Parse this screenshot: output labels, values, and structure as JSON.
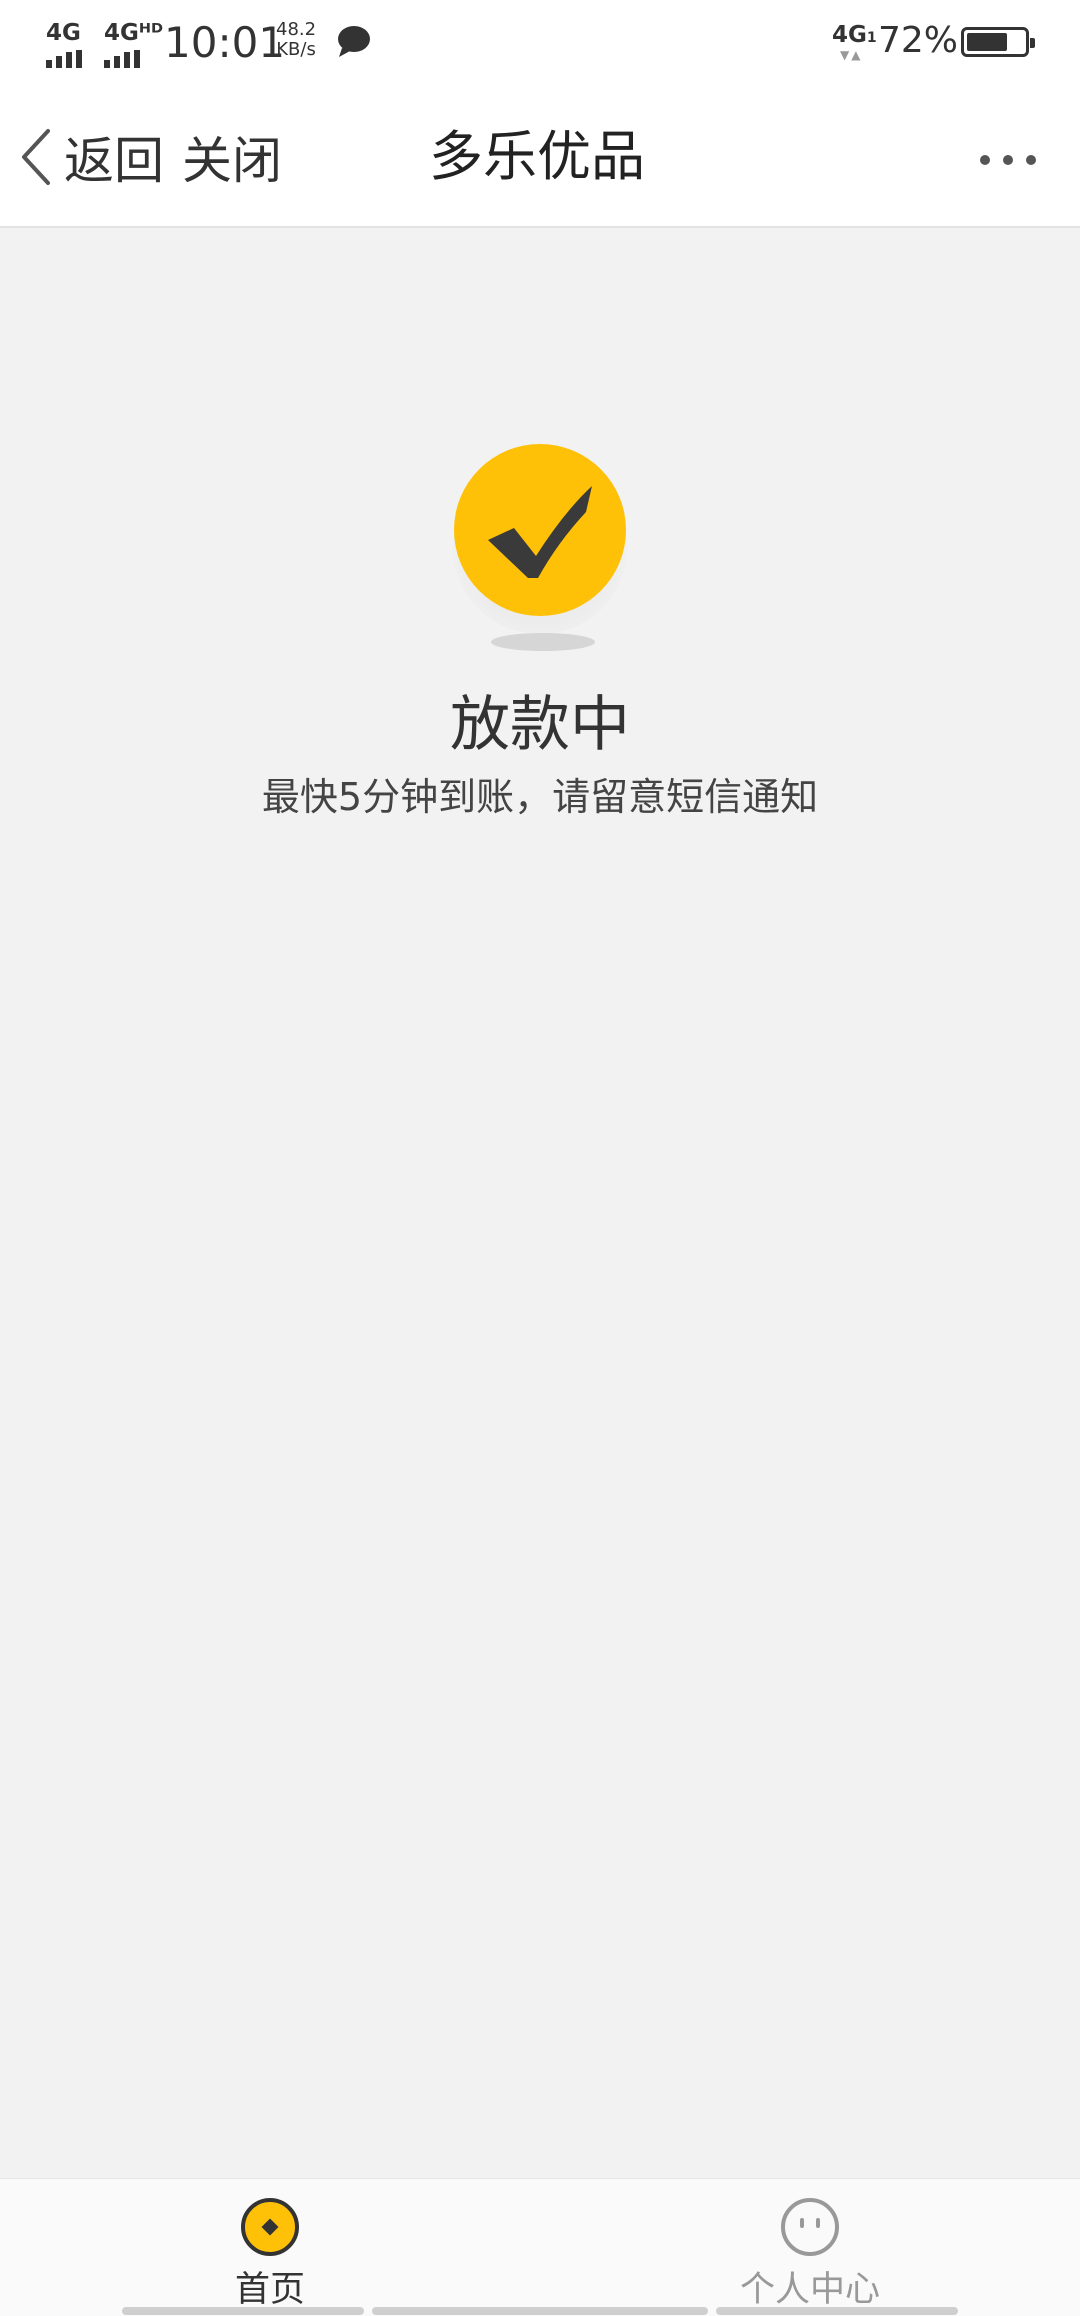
{
  "status_bar": {
    "sim1_label": "4G",
    "sim2_label": "4Gᴴᴰ",
    "time": "10:01",
    "net_speed_value": "48.2",
    "net_speed_unit": "KB/s",
    "right_network": "4G",
    "right_network_sub": "1",
    "battery_percent": "72%",
    "battery_level": 0.72
  },
  "nav": {
    "back_label": "返回",
    "close_label": "关闭",
    "title": "多乐优品"
  },
  "content": {
    "status_title": "放款中",
    "status_desc": "最快5分钟到账，请留意短信通知"
  },
  "tabs": [
    {
      "label": "首页",
      "active": true
    },
    {
      "label": "个人中心",
      "active": false
    }
  ],
  "colors": {
    "accent": "#FFC107",
    "check": "#3a3a3a",
    "background": "#f2f2f2",
    "active_tab_text": "#333333",
    "inactive_tab_text": "#999999"
  },
  "icons": {
    "back": "chevron-left-icon",
    "more": "more-dots-icon",
    "status": "check-circle-icon",
    "home_tab": "coin-icon",
    "profile_tab": "face-icon",
    "message": "chat-bubble-icon"
  }
}
